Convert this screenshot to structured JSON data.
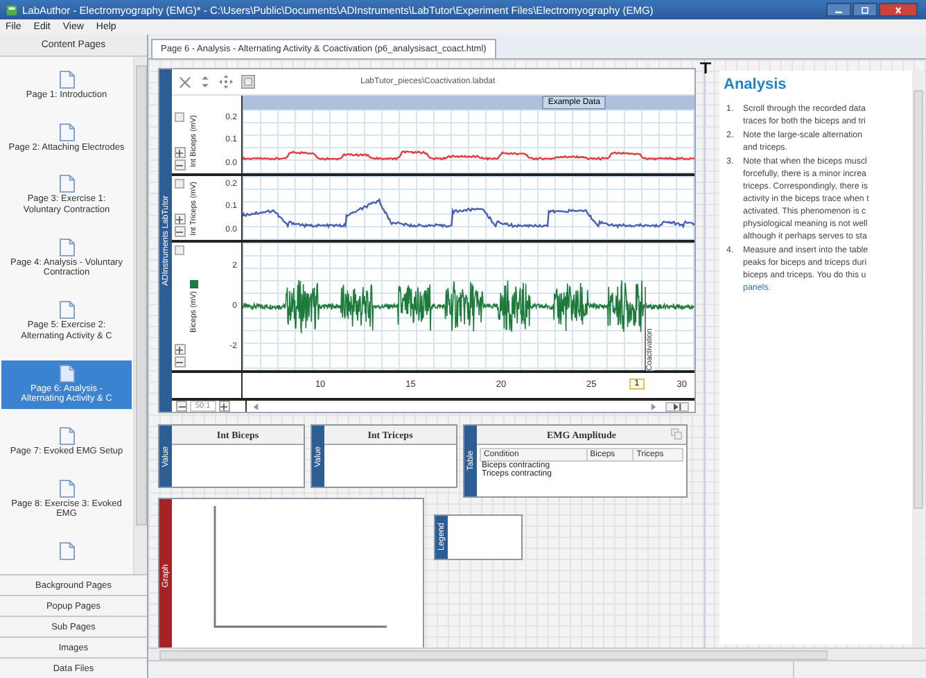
{
  "window": {
    "title": "LabAuthor - Electromyography (EMG)* - C:\\Users\\Public\\Documents\\ADInstruments\\LabTutor\\Experiment Files\\Electromyography (EMG)"
  },
  "menu": [
    "File",
    "Edit",
    "View",
    "Help"
  ],
  "sidebar": {
    "header": "Content Pages",
    "pages": [
      {
        "label": "Page 1: Introduction",
        "selected": false
      },
      {
        "label": "Page 2: Attaching Electrodes",
        "selected": false
      },
      {
        "label": "Page 3: Exercise 1: Voluntary Contraction",
        "selected": false
      },
      {
        "label": "Page 4: Analysis - Voluntary Contraction",
        "selected": false
      },
      {
        "label": "Page 5: Exercise 2: Alternating Activity & C",
        "selected": false
      },
      {
        "label": "Page 6: Analysis - Alternating Activity & C",
        "selected": true
      },
      {
        "label": "Page 7: Evoked EMG Setup",
        "selected": false
      },
      {
        "label": "Page 8: Exercise 3: Evoked EMG",
        "selected": false
      },
      {
        "selected": false
      }
    ],
    "sections": [
      "Background Pages",
      "Popup Pages",
      "Sub Pages",
      "Images",
      "Data Files"
    ]
  },
  "tab": {
    "label": "Page 6 - Analysis - Alternating Activity & Coactivation (p6_analysisact_coact.html)",
    "selected": true
  },
  "chart_panel": {
    "side_label": "ADInstruments LabTutor",
    "file": "LabTutor_pieces\\Coactivation.labdat",
    "banner": "Example Data",
    "channels": [
      {
        "name": "Int Biceps (mV)",
        "kind": "smooth",
        "color": "#e03a44",
        "ticks": [
          "0.2",
          "0.1",
          "0.0"
        ]
      },
      {
        "name": "Int Triceps (mV)",
        "kind": "smooth",
        "color": "#4a5fb0",
        "ticks": [
          "0.2",
          "0.1",
          "0.0"
        ]
      },
      {
        "name": "Biceps (mV)",
        "kind": "raw",
        "color": "#1c7a3a",
        "ticks": [
          "2",
          "0",
          "-2"
        ]
      }
    ],
    "xticks": [
      "10",
      "15",
      "20",
      "25",
      "30"
    ],
    "comment": {
      "number": "1",
      "text": "Coactivation"
    },
    "zoom": "50:1"
  },
  "widget_rows": [
    [
      {
        "kind": "value",
        "side_label": "Value",
        "title": "Int Biceps"
      },
      {
        "kind": "value",
        "side_label": "Value",
        "title": "Int Triceps"
      },
      {
        "kind": "table",
        "side_label": "Table",
        "title": "EMG Amplitude",
        "columns": [
          "Condition",
          "Biceps",
          "Triceps"
        ],
        "rows": [
          "Biceps contracting",
          "Triceps contracting"
        ]
      }
    ],
    [
      {
        "kind": "graph",
        "side_label": "Graph"
      },
      {
        "kind": "legend",
        "side_label": "Legend"
      }
    ]
  ],
  "analysis": {
    "title": "Analysis",
    "steps": [
      {
        "number": "1.",
        "lines": [
          "Scroll through the recorded data",
          "traces for both the biceps and tri"
        ]
      },
      {
        "number": "2.",
        "lines": [
          "Note the large-scale alternation",
          "and triceps."
        ]
      },
      {
        "number": "3.",
        "lines": [
          "Note that when the biceps muscl",
          "forcefully, there is a minor increa",
          "triceps. Correspondingly, there is",
          "activity in the biceps trace when t",
          "activated. This phenomenon is c",
          "physiological meaning is not well",
          "although it perhaps serves to sta"
        ]
      },
      {
        "number": "4.",
        "lines": [
          "Measure and insert into the table",
          "peaks for biceps and triceps duri",
          "biceps and triceps. You do this u"
        ],
        "link": "panels."
      }
    ]
  }
}
